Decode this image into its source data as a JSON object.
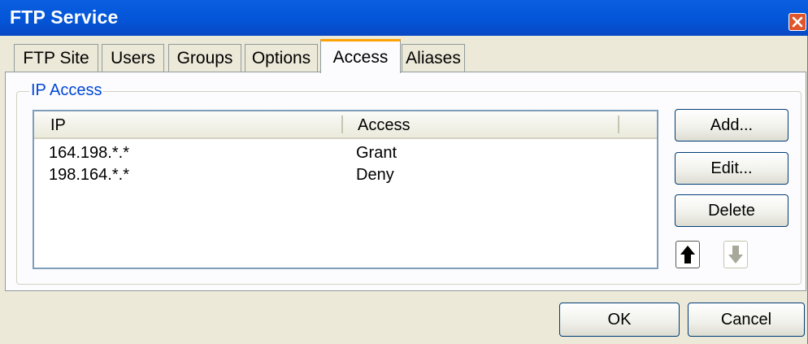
{
  "window": {
    "title": "FTP Service"
  },
  "tabs": [
    {
      "label": "FTP Site"
    },
    {
      "label": "Users"
    },
    {
      "label": "Groups"
    },
    {
      "label": "Options"
    },
    {
      "label": "Access",
      "active": true
    },
    {
      "label": "Aliases"
    }
  ],
  "ip_access": {
    "group_label": "IP Access",
    "columns": [
      "IP",
      "Access"
    ],
    "rows": [
      {
        "ip": "164.198.*.*",
        "access": "Grant"
      },
      {
        "ip": "198.164.*.*",
        "access": "Deny"
      }
    ]
  },
  "buttons": {
    "add": "Add...",
    "edit": "Edit...",
    "delete": "Delete",
    "ok": "OK",
    "cancel": "Cancel"
  },
  "icons": {
    "close": "close-icon",
    "move_up": "arrow-up-icon",
    "move_down": "arrow-down-icon"
  },
  "colors": {
    "titlebar": "#0455d8",
    "active_tab_accent": "#ffa200",
    "group_label": "#0046d5",
    "close_button": "#e0562c"
  }
}
